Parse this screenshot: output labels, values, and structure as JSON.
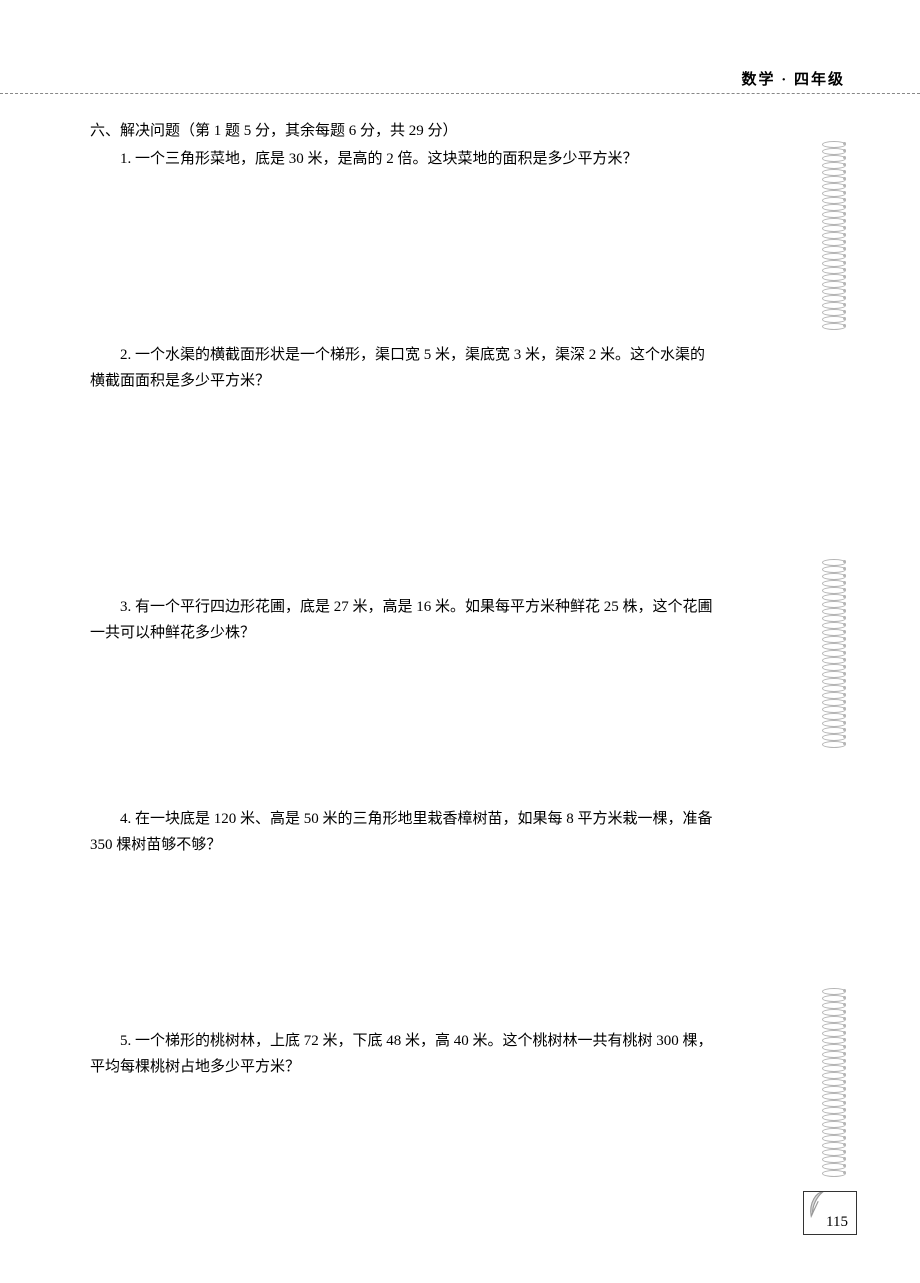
{
  "header": {
    "subject_grade": "数学 · 四年级"
  },
  "section": {
    "title": "六、解决问题（第 1 题 5 分，其余每题 6 分，共 29 分）"
  },
  "problems": {
    "p1": {
      "line1": "1. 一个三角形菜地，底是 30 米，是高的 2 倍。这块菜地的面积是多少平方米？"
    },
    "p2": {
      "line1": "2. 一个水渠的横截面形状是一个梯形，渠口宽 5 米，渠底宽 3 米，渠深 2 米。这个水渠的",
      "line2": "横截面面积是多少平方米？"
    },
    "p3": {
      "line1": "3. 有一个平行四边形花圃，底是 27 米，高是 16 米。如果每平方米种鲜花 25 株，这个花圃",
      "line2": "一共可以种鲜花多少株？"
    },
    "p4": {
      "line1": "4. 在一块底是 120 米、高是 50 米的三角形地里栽香樟树苗，如果每 8 平方米栽一棵，准备",
      "line2": "350 棵树苗够不够？"
    },
    "p5": {
      "line1": "5. 一个梯形的桃树林，上底 72 米，下底 48 米，高 40 米。这个桃树林一共有桃树 300 棵，",
      "line2": "平均每棵桃树占地多少平方米？"
    }
  },
  "page_number": "115"
}
